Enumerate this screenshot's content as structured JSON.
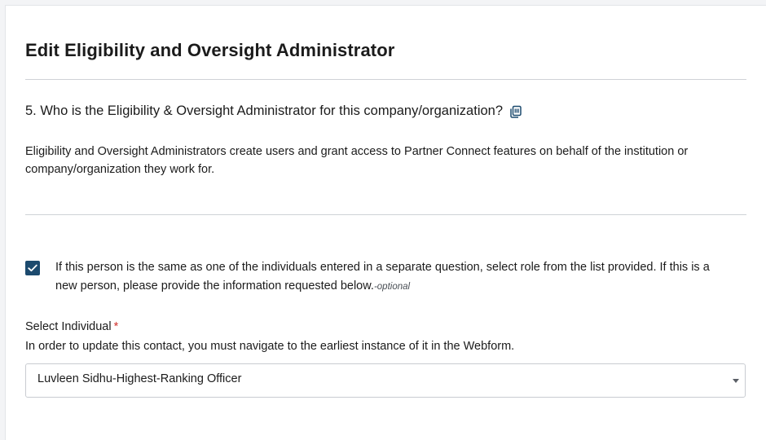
{
  "form": {
    "title": "Edit Eligibility and Oversight Administrator",
    "question": "5. Who is the Eligibility & Oversight Administrator for this company/organization?",
    "question_icon": "copy-icon",
    "description": "Eligibility and Oversight Administrators create users and grant access to Partner Connect features on behalf of the institution or company/organization they work for.",
    "checkbox": {
      "checked": true,
      "label": "If this person is the same as one of the individuals entered in a separate question, select role from the list provided. If this is a new person, please provide the information requested below.",
      "optional_tag": "-optional"
    },
    "select_individual": {
      "label": "Select Individual",
      "required_marker": "*",
      "hint": "In order to update this contact, you must navigate to the earliest instance of it in the Webform.",
      "value": "Luvleen Sidhu-Highest-Ranking Officer"
    }
  },
  "colors": {
    "checkbox_fill": "#1c4a6e",
    "required": "#d0312d",
    "divider": "#cfd2d6"
  }
}
